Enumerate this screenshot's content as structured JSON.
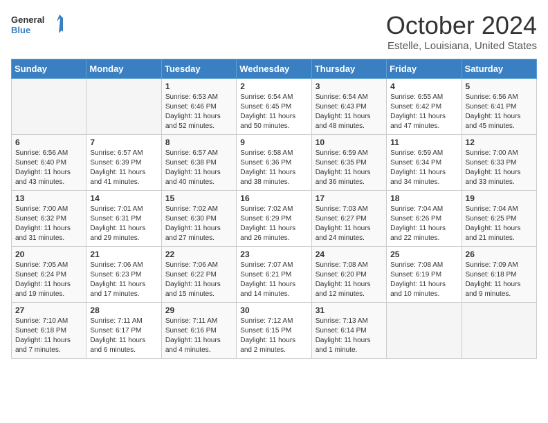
{
  "logo": {
    "line1": "General",
    "line2": "Blue"
  },
  "title": "October 2024",
  "subtitle": "Estelle, Louisiana, United States",
  "weekdays": [
    "Sunday",
    "Monday",
    "Tuesday",
    "Wednesday",
    "Thursday",
    "Friday",
    "Saturday"
  ],
  "weeks": [
    [
      {
        "day": "",
        "info": ""
      },
      {
        "day": "",
        "info": ""
      },
      {
        "day": "1",
        "info": "Sunrise: 6:53 AM\nSunset: 6:46 PM\nDaylight: 11 hours and 52 minutes."
      },
      {
        "day": "2",
        "info": "Sunrise: 6:54 AM\nSunset: 6:45 PM\nDaylight: 11 hours and 50 minutes."
      },
      {
        "day": "3",
        "info": "Sunrise: 6:54 AM\nSunset: 6:43 PM\nDaylight: 11 hours and 48 minutes."
      },
      {
        "day": "4",
        "info": "Sunrise: 6:55 AM\nSunset: 6:42 PM\nDaylight: 11 hours and 47 minutes."
      },
      {
        "day": "5",
        "info": "Sunrise: 6:56 AM\nSunset: 6:41 PM\nDaylight: 11 hours and 45 minutes."
      }
    ],
    [
      {
        "day": "6",
        "info": "Sunrise: 6:56 AM\nSunset: 6:40 PM\nDaylight: 11 hours and 43 minutes."
      },
      {
        "day": "7",
        "info": "Sunrise: 6:57 AM\nSunset: 6:39 PM\nDaylight: 11 hours and 41 minutes."
      },
      {
        "day": "8",
        "info": "Sunrise: 6:57 AM\nSunset: 6:38 PM\nDaylight: 11 hours and 40 minutes."
      },
      {
        "day": "9",
        "info": "Sunrise: 6:58 AM\nSunset: 6:36 PM\nDaylight: 11 hours and 38 minutes."
      },
      {
        "day": "10",
        "info": "Sunrise: 6:59 AM\nSunset: 6:35 PM\nDaylight: 11 hours and 36 minutes."
      },
      {
        "day": "11",
        "info": "Sunrise: 6:59 AM\nSunset: 6:34 PM\nDaylight: 11 hours and 34 minutes."
      },
      {
        "day": "12",
        "info": "Sunrise: 7:00 AM\nSunset: 6:33 PM\nDaylight: 11 hours and 33 minutes."
      }
    ],
    [
      {
        "day": "13",
        "info": "Sunrise: 7:00 AM\nSunset: 6:32 PM\nDaylight: 11 hours and 31 minutes."
      },
      {
        "day": "14",
        "info": "Sunrise: 7:01 AM\nSunset: 6:31 PM\nDaylight: 11 hours and 29 minutes."
      },
      {
        "day": "15",
        "info": "Sunrise: 7:02 AM\nSunset: 6:30 PM\nDaylight: 11 hours and 27 minutes."
      },
      {
        "day": "16",
        "info": "Sunrise: 7:02 AM\nSunset: 6:29 PM\nDaylight: 11 hours and 26 minutes."
      },
      {
        "day": "17",
        "info": "Sunrise: 7:03 AM\nSunset: 6:27 PM\nDaylight: 11 hours and 24 minutes."
      },
      {
        "day": "18",
        "info": "Sunrise: 7:04 AM\nSunset: 6:26 PM\nDaylight: 11 hours and 22 minutes."
      },
      {
        "day": "19",
        "info": "Sunrise: 7:04 AM\nSunset: 6:25 PM\nDaylight: 11 hours and 21 minutes."
      }
    ],
    [
      {
        "day": "20",
        "info": "Sunrise: 7:05 AM\nSunset: 6:24 PM\nDaylight: 11 hours and 19 minutes."
      },
      {
        "day": "21",
        "info": "Sunrise: 7:06 AM\nSunset: 6:23 PM\nDaylight: 11 hours and 17 minutes."
      },
      {
        "day": "22",
        "info": "Sunrise: 7:06 AM\nSunset: 6:22 PM\nDaylight: 11 hours and 15 minutes."
      },
      {
        "day": "23",
        "info": "Sunrise: 7:07 AM\nSunset: 6:21 PM\nDaylight: 11 hours and 14 minutes."
      },
      {
        "day": "24",
        "info": "Sunrise: 7:08 AM\nSunset: 6:20 PM\nDaylight: 11 hours and 12 minutes."
      },
      {
        "day": "25",
        "info": "Sunrise: 7:08 AM\nSunset: 6:19 PM\nDaylight: 11 hours and 10 minutes."
      },
      {
        "day": "26",
        "info": "Sunrise: 7:09 AM\nSunset: 6:18 PM\nDaylight: 11 hours and 9 minutes."
      }
    ],
    [
      {
        "day": "27",
        "info": "Sunrise: 7:10 AM\nSunset: 6:18 PM\nDaylight: 11 hours and 7 minutes."
      },
      {
        "day": "28",
        "info": "Sunrise: 7:11 AM\nSunset: 6:17 PM\nDaylight: 11 hours and 6 minutes."
      },
      {
        "day": "29",
        "info": "Sunrise: 7:11 AM\nSunset: 6:16 PM\nDaylight: 11 hours and 4 minutes."
      },
      {
        "day": "30",
        "info": "Sunrise: 7:12 AM\nSunset: 6:15 PM\nDaylight: 11 hours and 2 minutes."
      },
      {
        "day": "31",
        "info": "Sunrise: 7:13 AM\nSunset: 6:14 PM\nDaylight: 11 hours and 1 minute."
      },
      {
        "day": "",
        "info": ""
      },
      {
        "day": "",
        "info": ""
      }
    ]
  ]
}
